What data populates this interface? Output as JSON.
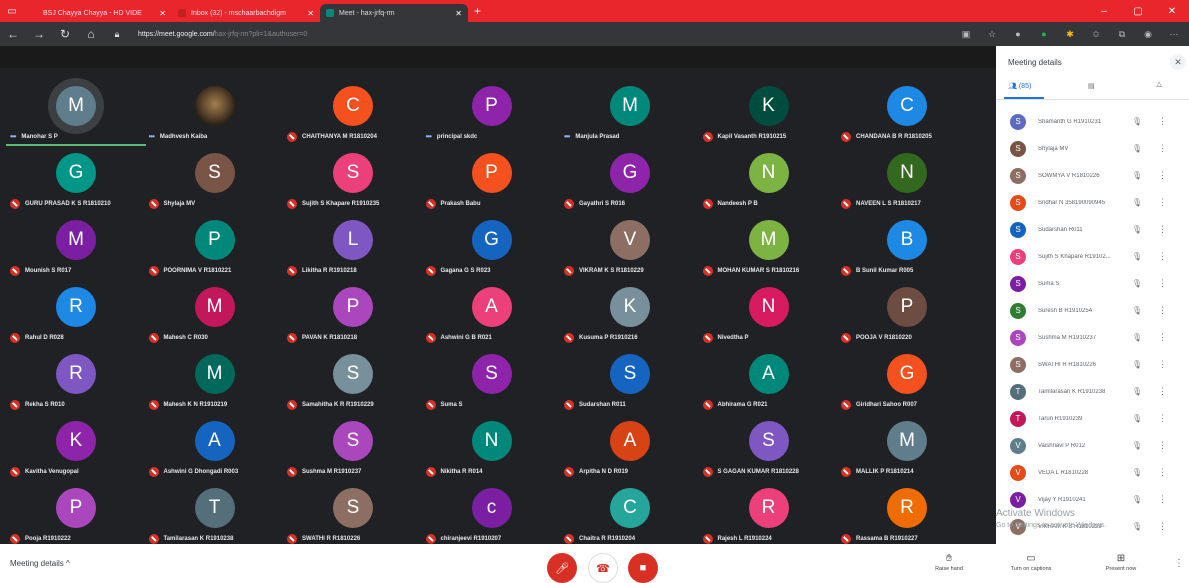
{
  "browser": {
    "tabs": [
      {
        "label": "BSJ Chayya Chayya - HD VIDE",
        "color": "#e8262c"
      },
      {
        "label": "Inbox (32) - mschaarbachdigm",
        "color": "#c5221f"
      },
      {
        "label": "Meet - hax-jrfq-rm",
        "color": "#00897b"
      }
    ],
    "new_tab": "+",
    "url_main": "https://meet.google.com/",
    "url_rest": "hax-jrfq-rm?pli=1&authuser=0",
    "window_controls": [
      "–",
      "▢",
      "✕"
    ]
  },
  "participants": [
    {
      "name": "Manohar S P",
      "initial": "M",
      "color": "#607d8b",
      "state": "speaking"
    },
    {
      "name": "Madhvesh Kaiba",
      "initial": "",
      "color": "#6b5134",
      "state": "speaking",
      "photo": true
    },
    {
      "name": "CHAITHANYA M R1810204",
      "initial": "C",
      "color": "#f4511e",
      "state": "muted"
    },
    {
      "name": "principal skdc",
      "initial": "P",
      "color": "#8e24aa",
      "state": "speaking"
    },
    {
      "name": "Manjula Prasad",
      "initial": "M",
      "color": "#00897b",
      "state": "speaking"
    },
    {
      "name": "Kapil Vasanth R1910215",
      "initial": "K",
      "color": "#004d40",
      "state": "muted"
    },
    {
      "name": "CHANDANA B R R1810205",
      "initial": "C",
      "color": "#1e88e5",
      "state": "muted"
    },
    {
      "name": "GURU PRASAD K S R1810210",
      "initial": "G",
      "color": "#009688",
      "state": "muted"
    },
    {
      "name": "Shylaja MV",
      "initial": "S",
      "color": "#795548",
      "state": "muted"
    },
    {
      "name": "Sujith S Khapare R1910235",
      "initial": "S",
      "color": "#ec407a",
      "state": "muted"
    },
    {
      "name": "Prakash Babu",
      "initial": "P",
      "color": "#f4511e",
      "state": "muted"
    },
    {
      "name": "Gayathri S R016",
      "initial": "G",
      "color": "#8e24aa",
      "state": "muted"
    },
    {
      "name": "Nandeesh P B",
      "initial": "N",
      "color": "#7cb342",
      "state": "muted"
    },
    {
      "name": "NAVEEN L S R1810217",
      "initial": "N",
      "color": "#33691e",
      "state": "muted"
    },
    {
      "name": "Mounish S R017",
      "initial": "M",
      "color": "#7b1fa2",
      "state": "muted"
    },
    {
      "name": "POORNIMA V R1810221",
      "initial": "P",
      "color": "#00897b",
      "state": "muted"
    },
    {
      "name": "Likitha R R1910218",
      "initial": "L",
      "color": "#7e57c2",
      "state": "muted"
    },
    {
      "name": "Gagana G S R023",
      "initial": "G",
      "color": "#1565c0",
      "state": "muted"
    },
    {
      "name": "VIKRAM K S R1810229",
      "initial": "V",
      "color": "#8d6e63",
      "state": "muted"
    },
    {
      "name": "MOHAN KUMAR S R1810216",
      "initial": "M",
      "color": "#7cb342",
      "state": "muted"
    },
    {
      "name": "B Sunil Kumar R005",
      "initial": "B",
      "color": "#1e88e5",
      "state": "muted"
    },
    {
      "name": "Rahul D R028",
      "initial": "R",
      "color": "#1e88e5",
      "state": "muted"
    },
    {
      "name": "Mahesh C R030",
      "initial": "M",
      "color": "#c2185b",
      "state": "muted"
    },
    {
      "name": "PAVAN K R1810218",
      "initial": "P",
      "color": "#ab47bc",
      "state": "muted"
    },
    {
      "name": "Ashwini G B R021",
      "initial": "A",
      "color": "#ec407a",
      "state": "muted"
    },
    {
      "name": "Kusuma P R1910216",
      "initial": "K",
      "color": "#78909c",
      "state": "muted"
    },
    {
      "name": "Nivedtha P",
      "initial": "N",
      "color": "#d81b60",
      "state": "muted"
    },
    {
      "name": "POOJA V R1810220",
      "initial": "P",
      "color": "#6d4c41",
      "state": "muted"
    },
    {
      "name": "Rekha S R010",
      "initial": "R",
      "color": "#7e57c2",
      "state": "muted"
    },
    {
      "name": "Mahesh K N R1910219",
      "initial": "M",
      "color": "#00695c",
      "state": "muted"
    },
    {
      "name": "Samahitha K R R1910229",
      "initial": "S",
      "color": "#78909c",
      "state": "muted"
    },
    {
      "name": "Suma S",
      "initial": "S",
      "color": "#8e24aa",
      "state": "muted"
    },
    {
      "name": "Sudarshan R011",
      "initial": "S",
      "color": "#1565c0",
      "state": "muted"
    },
    {
      "name": "Abhirama G R021",
      "initial": "A",
      "color": "#00897b",
      "state": "muted"
    },
    {
      "name": "Giridhari Sahoo R007",
      "initial": "G",
      "color": "#f4511e",
      "state": "muted"
    },
    {
      "name": "Kavitha Venugopal",
      "initial": "K",
      "color": "#8e24aa",
      "state": "muted"
    },
    {
      "name": "Ashwini G Dhongadi R003",
      "initial": "A",
      "color": "#1565c0",
      "state": "muted"
    },
    {
      "name": "Sushma M R1910237",
      "initial": "S",
      "color": "#ab47bc",
      "state": "muted"
    },
    {
      "name": "Nikitha R R014",
      "initial": "N",
      "color": "#00897b",
      "state": "muted"
    },
    {
      "name": "Arpitha N D R019",
      "initial": "A",
      "color": "#d84315",
      "state": "muted"
    },
    {
      "name": "S GAGAN KUMAR R1810228",
      "initial": "S",
      "color": "#7e57c2",
      "state": "muted"
    },
    {
      "name": "MALLIK P R1810214",
      "initial": "M",
      "color": "#607d8b",
      "state": "muted"
    },
    {
      "name": "Pooja R1910222",
      "initial": "P",
      "color": "#ab47bc",
      "state": "muted"
    },
    {
      "name": "Tamilarasan K R1910238",
      "initial": "T",
      "color": "#546e7a",
      "state": "muted"
    },
    {
      "name": "SWATHI R R1810226",
      "initial": "S",
      "color": "#8d6e63",
      "state": "muted"
    },
    {
      "name": "chiranjeevi R1910207",
      "initial": "c",
      "color": "#7b1fa2",
      "state": "muted"
    },
    {
      "name": "Chaitra R R1910204",
      "initial": "C",
      "color": "#26a69a",
      "state": "muted"
    },
    {
      "name": "Rajesh L R1910224",
      "initial": "R",
      "color": "#ec407a",
      "state": "muted"
    },
    {
      "name": "Rassama B R1910227",
      "initial": "R",
      "color": "#ef6c00",
      "state": "muted"
    }
  ],
  "panel": {
    "title": "Meeting details",
    "close": "✕",
    "tab_people": "(85)",
    "list": [
      {
        "name": "Shamanth G R1910231",
        "initial": "S",
        "color": "#5c6bc0"
      },
      {
        "name": "Shylaja MV",
        "initial": "S",
        "color": "#795548"
      },
      {
        "name": "SOWMYA V R1810226",
        "initial": "S",
        "color": "#8d6e63"
      },
      {
        "name": "Sridhar N 358190090945",
        "initial": "S",
        "color": "#e64a19"
      },
      {
        "name": "Sudarshan R011",
        "initial": "S",
        "color": "#1565c0"
      },
      {
        "name": "Sujith S Khapare R19102...",
        "initial": "S",
        "color": "#ec407a"
      },
      {
        "name": "Suma S",
        "initial": "S",
        "color": "#7b1fa2"
      },
      {
        "name": "Suresh B R1910254",
        "initial": "S",
        "color": "#2e7d32"
      },
      {
        "name": "Sushma M R1910237",
        "initial": "S",
        "color": "#ab47bc"
      },
      {
        "name": "SWATHI R R1810226",
        "initial": "S",
        "color": "#8d6e63"
      },
      {
        "name": "Tamilarasan K R1910238",
        "initial": "T",
        "color": "#546e7a"
      },
      {
        "name": "Tarun R1910239",
        "initial": "T",
        "color": "#c2185b"
      },
      {
        "name": "Vaishnavi P R012",
        "initial": "V",
        "color": "#607d8b"
      },
      {
        "name": "VEDA L R1810228",
        "initial": "V",
        "color": "#e64a19"
      },
      {
        "name": "Vijay Y R1910241",
        "initial": "V",
        "color": "#7b1fa2"
      },
      {
        "name": "VIKRAM K S R1810229",
        "initial": "V",
        "color": "#8d6e63"
      }
    ]
  },
  "bottom": {
    "meeting_details": "Meeting details",
    "chevron": "^",
    "raise_hand": "Raise hand",
    "captions": "Turn on captions",
    "present": "Present now",
    "more": "⋮"
  },
  "watermark": {
    "line1": "Activate Windows",
    "line2": "Go to Settings to activate Windows."
  }
}
